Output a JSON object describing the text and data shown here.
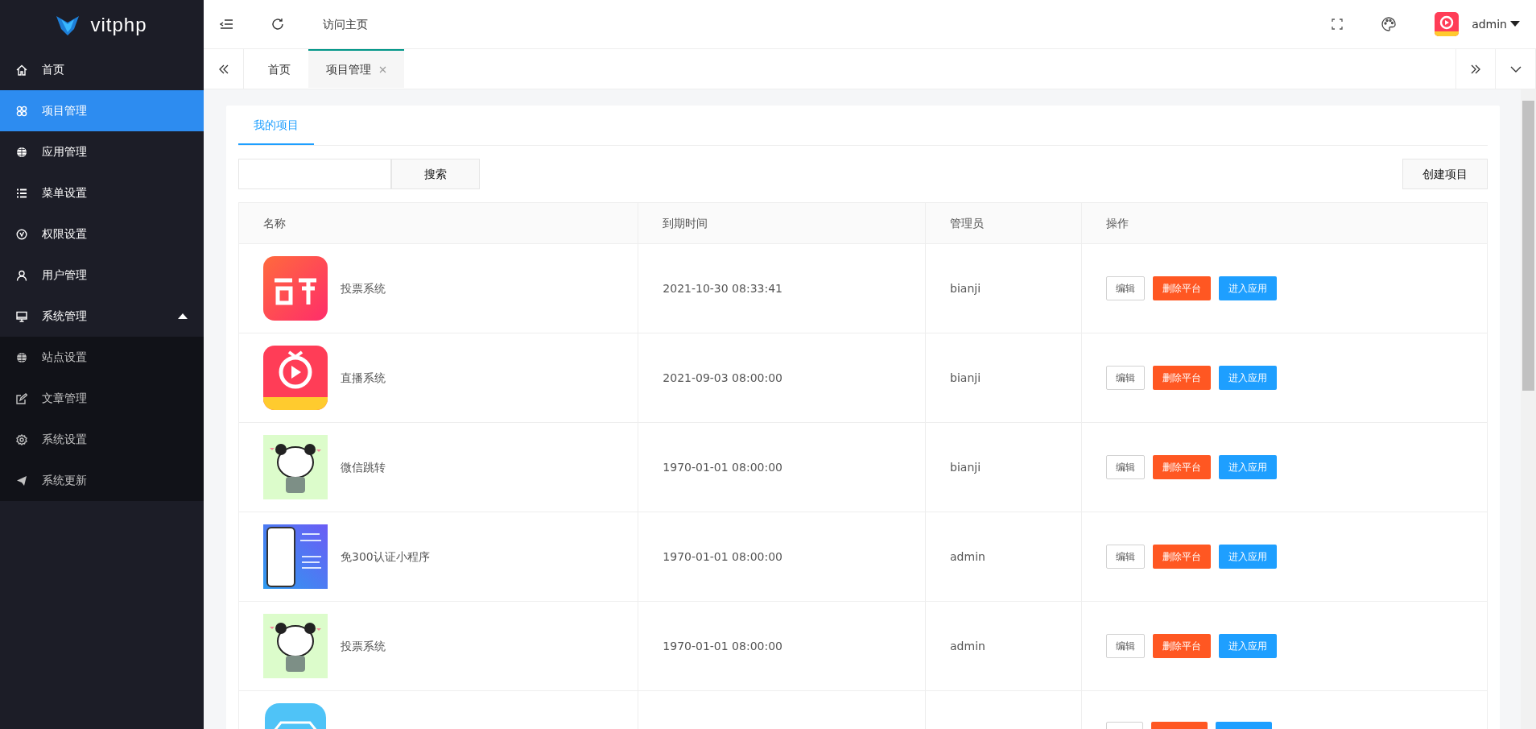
{
  "sidebar": {
    "logo_text": "vitphp",
    "items": [
      {
        "label": "首页",
        "selected": false
      },
      {
        "label": "项目管理",
        "selected": true
      },
      {
        "label": "应用管理",
        "selected": false
      },
      {
        "label": "菜单设置",
        "selected": false
      },
      {
        "label": "权限设置",
        "selected": false
      },
      {
        "label": "用户管理",
        "selected": false
      },
      {
        "label": "系统管理",
        "selected": false,
        "expanded": true,
        "children": [
          {
            "label": "站点设置",
            "selected": false
          },
          {
            "label": "文章管理",
            "selected": false
          },
          {
            "label": "系统设置",
            "selected": false
          },
          {
            "label": "系统更新",
            "selected": false
          }
        ]
      }
    ]
  },
  "header": {
    "home_link": "访问主页",
    "user": "admin"
  },
  "page_tabs": [
    {
      "label": "首页",
      "selected": false,
      "closable": false
    },
    {
      "label": "项目管理",
      "selected": true,
      "closable": true
    }
  ],
  "content": {
    "tabs": [
      {
        "label": "我的项目",
        "selected": true
      }
    ],
    "search_button": "搜索",
    "create_button": "创建项目",
    "table": {
      "columns": [
        "名称",
        "到期时间",
        "管理员",
        "操作"
      ],
      "rows": [
        {
          "thumb": {
            "kind": "sale-logo"
          },
          "name": "投票系统",
          "expires": "2021-10-30 08:33:41",
          "admin": "bianji",
          "actions": [
            {
              "kind": "default",
              "label": "编辑"
            },
            {
              "kind": "danger",
              "label": "删除平台"
            },
            {
              "kind": "primary",
              "label": "进入应用"
            }
          ]
        },
        {
          "thumb": {
            "kind": "play-logo"
          },
          "name": "直播系统",
          "expires": "2021-09-03 08:00:00",
          "admin": "bianji",
          "actions": [
            {
              "kind": "default",
              "label": "编辑"
            },
            {
              "kind": "danger",
              "label": "删除平台"
            },
            {
              "kind": "primary",
              "label": "进入应用"
            }
          ]
        },
        {
          "thumb": {
            "kind": "cartoon"
          },
          "name": "微信跳转",
          "expires": "1970-01-01 08:00:00",
          "admin": "bianji",
          "actions": [
            {
              "kind": "default",
              "label": "编辑"
            },
            {
              "kind": "danger",
              "label": "删除平台"
            },
            {
              "kind": "primary",
              "label": "进入应用"
            }
          ]
        },
        {
          "thumb": {
            "kind": "phone-ad"
          },
          "name": "免300认证小程序",
          "expires": "1970-01-01 08:00:00",
          "admin": "admin",
          "actions": [
            {
              "kind": "default",
              "label": "编辑"
            },
            {
              "kind": "danger",
              "label": "删除平台"
            },
            {
              "kind": "primary",
              "label": "进入应用"
            }
          ]
        },
        {
          "thumb": {
            "kind": "cartoon"
          },
          "name": "投票系统",
          "expires": "1970-01-01 08:00:00",
          "admin": "admin",
          "actions": [
            {
              "kind": "default",
              "label": "编辑"
            },
            {
              "kind": "danger",
              "label": "删除平台"
            },
            {
              "kind": "primary",
              "label": "进入应用"
            }
          ]
        },
        {
          "thumb": {
            "kind": "car-logo"
          },
          "actions": [
            {
              "kind": "default"
            },
            {
              "kind": "danger"
            },
            {
              "kind": "primary"
            }
          ]
        }
      ]
    }
  }
}
